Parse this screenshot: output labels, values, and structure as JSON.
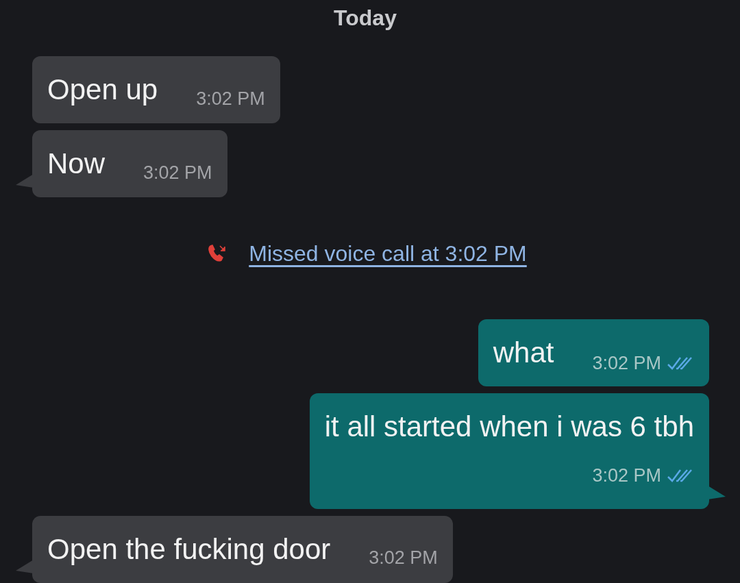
{
  "date_label": "Today",
  "messages": [
    {
      "kind": "incoming",
      "text": "Open up",
      "time": "3:02 PM",
      "tail": false
    },
    {
      "kind": "incoming",
      "text": "Now",
      "time": "3:02 PM",
      "tail": true
    },
    {
      "kind": "call",
      "text": "Missed voice call at 3:02 PM"
    },
    {
      "kind": "outgoing",
      "text": "what",
      "time": "3:02 PM",
      "tail": false,
      "read": true,
      "stacked": false
    },
    {
      "kind": "outgoing",
      "text": "it all started when i was 6 tbh",
      "time": "3:02 PM",
      "tail": true,
      "read": true,
      "stacked": true
    },
    {
      "kind": "incoming",
      "text": "Open the fucking door",
      "time": "3:02 PM",
      "tail": true
    }
  ]
}
